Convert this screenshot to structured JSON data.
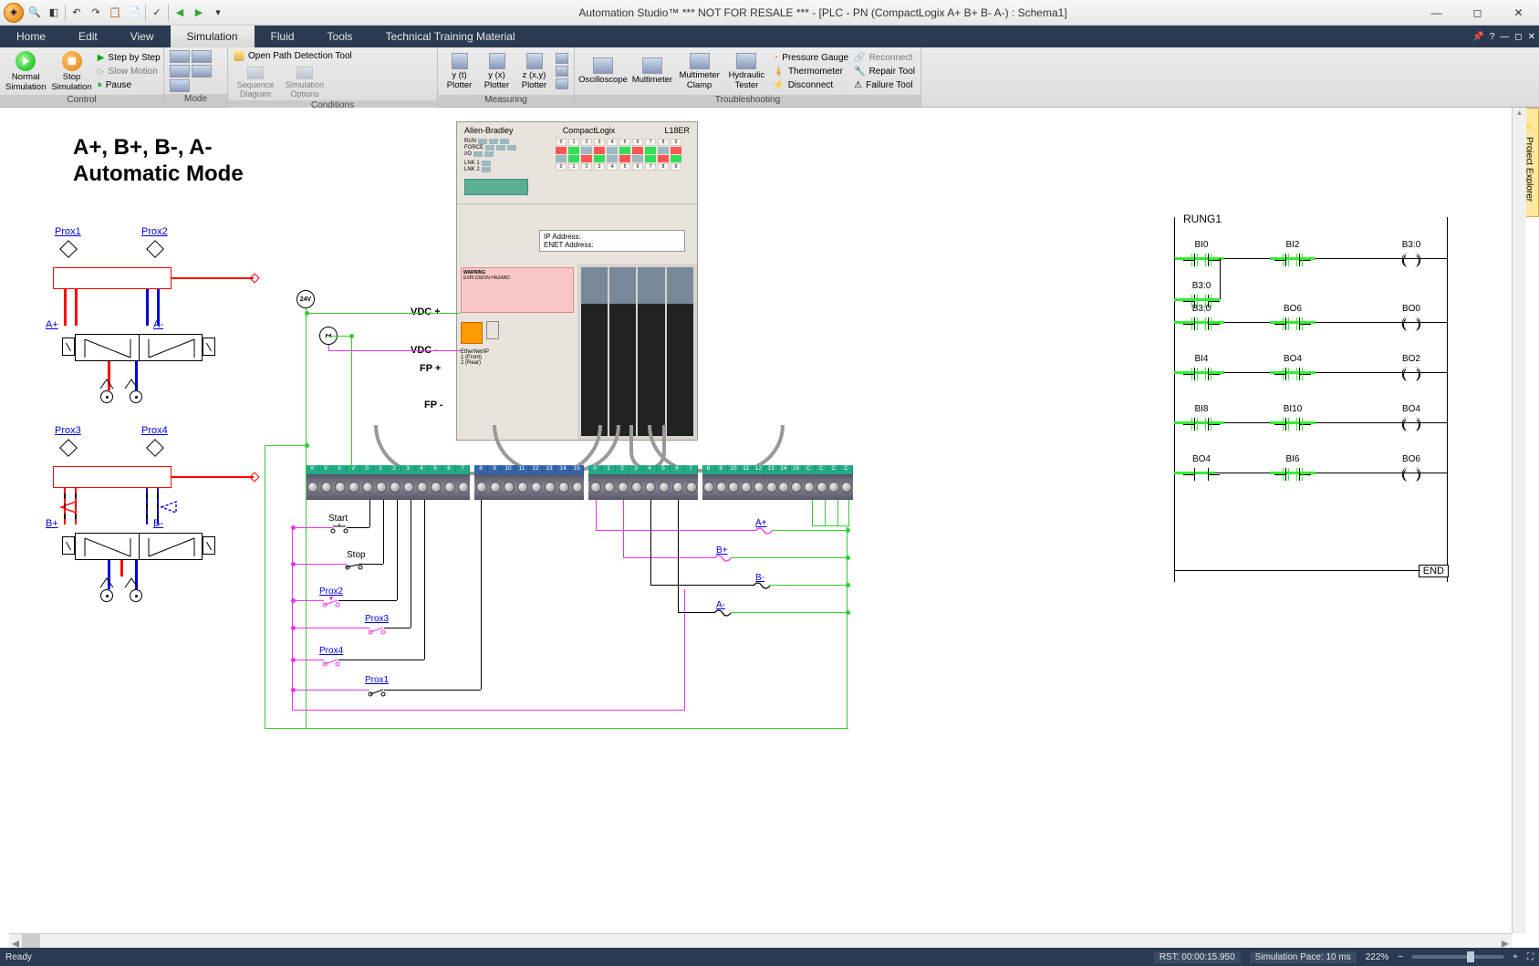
{
  "window": {
    "title": "Automation Studio™   *** NOT FOR RESALE ***    - [PLC - PN  (CompactLogix A+ B+ B- A-) : Schema1]"
  },
  "tabs": [
    "Home",
    "Edit",
    "View",
    "Simulation",
    "Fluid",
    "Tools",
    "Technical Training Material"
  ],
  "active_tab": "Simulation",
  "ribbon": {
    "control": {
      "label": "Control",
      "normal_sim": "Normal Simulation",
      "stop_sim": "Stop Simulation",
      "step": "Step by Step",
      "slow": "Slow Motion",
      "pause": "Pause"
    },
    "mode": {
      "label": "Mode"
    },
    "conditions": {
      "label": "Conditions",
      "open_path": "Open Path Detection Tool",
      "seq_diag": "Sequence Diagram",
      "sim_opts": "Simulation Options"
    },
    "measuring": {
      "label": "Measuring",
      "yt": "y (t) Plotter",
      "yx": "y (x) Plotter",
      "zxy": "z (x,y) Plotter"
    },
    "troubleshooting": {
      "label": "Troubleshooting",
      "osc": "Oscilloscope",
      "mm": "Multimeter",
      "mmc": "Multimeter Clamp",
      "hyd": "Hydraulic Tester",
      "press": "Pressure Gauge",
      "thermo": "Thermometer",
      "disc": "Disconnect",
      "recon": "Reconnect",
      "repair": "Repair Tool",
      "failure": "Failure Tool"
    }
  },
  "diagram": {
    "title_l1": "A+, B+, B-, A-",
    "title_l2": "Automatic Mode",
    "prox": [
      "Prox1",
      "Prox2",
      "Prox3",
      "Prox4"
    ],
    "solenoids": [
      "A+",
      "A-",
      "B+",
      "B-"
    ],
    "plc": {
      "brand": "Allen-Bradley",
      "family": "CompactLogix",
      "model": "L18ER",
      "status_groups": [
        "RUN",
        "FORCE",
        "I/O"
      ],
      "lnk": [
        "LNK 1",
        "LNK 2"
      ],
      "io_nums": [
        "0",
        "1",
        "2",
        "3",
        "4",
        "5",
        "6",
        "7",
        "8",
        "9",
        "10",
        "11",
        "12",
        "13",
        "14",
        "15"
      ],
      "ip_label": "IP Address:",
      "enet_label": "ENET Address:",
      "warn_title": "WARNING",
      "warn_sub": "EXPLOSION HAZARD",
      "enet_leds": [
        "1 (Front)",
        "2 (Rear)"
      ]
    },
    "power": {
      "vdc_p": "VDC +",
      "vdc_n": "VDC -",
      "fp_p": "FP +",
      "fp_n": "FP -",
      "src24": "24V",
      "src0": "0V"
    },
    "terminals": {
      "strip1": [
        "V",
        "V",
        "V",
        "V",
        "0",
        "1",
        "2",
        "3",
        "4",
        "5",
        "6",
        "7"
      ],
      "strip2": [
        "8",
        "9",
        "10",
        "11",
        "12",
        "13",
        "14",
        "15"
      ],
      "strip3": [
        "0",
        "1",
        "2",
        "3",
        "4",
        "5",
        "6",
        "7"
      ],
      "strip4": [
        "8",
        "9",
        "10",
        "11",
        "12",
        "13",
        "14",
        "15",
        "C",
        "C",
        "C",
        "C"
      ]
    },
    "inputs": {
      "start": "Start",
      "stop": "Stop",
      "p1": "Prox1",
      "p2": "Prox2",
      "p3": "Prox3",
      "p4": "Prox4"
    },
    "outputs": {
      "ap": "A+",
      "bp": "B+",
      "bn": "B-",
      "an": "A-"
    },
    "ladder": {
      "title": "RUNG1",
      "end": "END",
      "rungs": [
        {
          "els": [
            {
              "t": "xic",
              "l": "BI0",
              "pwr": true
            },
            {
              "t": "xio",
              "l": "BI2",
              "pwr": true
            },
            {
              "t": "ote",
              "l": "B3:0"
            }
          ],
          "branch": [
            {
              "t": "xic",
              "l": "B3:0",
              "pwr": true
            }
          ]
        },
        {
          "els": [
            {
              "t": "xic",
              "l": "B3:0",
              "pwr": true
            },
            {
              "t": "xic",
              "l": "BO6",
              "pwr": true
            },
            {
              "t": "ote",
              "l": "BO0"
            }
          ]
        },
        {
          "els": [
            {
              "t": "xic",
              "l": "BI4",
              "pwr": true
            },
            {
              "t": "xic",
              "l": "BO4",
              "pwr": true
            },
            {
              "t": "ote",
              "l": "BO2"
            }
          ]
        },
        {
          "els": [
            {
              "t": "xic",
              "l": "BI8",
              "pwr": true
            },
            {
              "t": "xio",
              "l": "BI10",
              "pwr": true
            },
            {
              "t": "ote",
              "l": "BO4"
            }
          ]
        },
        {
          "els": [
            {
              "t": "xic",
              "l": "BO4",
              "pwr": false
            },
            {
              "t": "xic",
              "l": "BI6",
              "pwr": true
            },
            {
              "t": "ote",
              "l": "BO6"
            }
          ]
        }
      ]
    }
  },
  "explorer": "Project Explorer",
  "status": {
    "ready": "Ready",
    "rst": "RST: 00:00:15.950",
    "pace": "Simulation Pace: 10 ms",
    "zoom": "222%"
  }
}
